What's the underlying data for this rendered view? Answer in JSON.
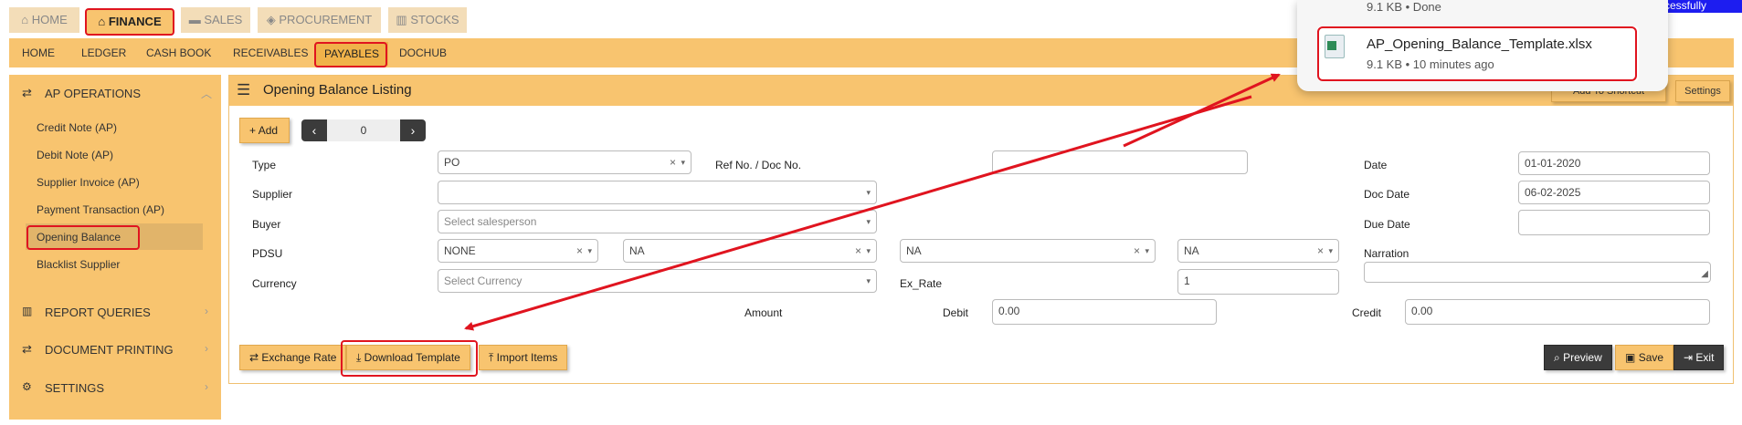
{
  "top_tabs": [
    "HOME",
    "FINANCE",
    "SALES",
    "PROCUREMENT",
    "STOCKS"
  ],
  "sub_nav": [
    "HOME",
    "LEDGER",
    "CASH BOOK",
    "RECEIVABLES",
    "PAYABLES",
    "DOCHUB"
  ],
  "sidebar": {
    "section": "AP OPERATIONS",
    "items": [
      "Credit Note (AP)",
      "Debit Note (AP)",
      "Supplier Invoice (AP)",
      "Payment Transaction (AP)",
      "Opening Balance",
      "Blacklist Supplier"
    ],
    "groups": [
      "REPORT QUERIES",
      "DOCUMENT PRINTING",
      "SETTINGS"
    ]
  },
  "panel": {
    "title": "Opening Balance Listing",
    "add_shortcut_label": "Add To Shortcut",
    "settings_label": "Settings",
    "add_label": "Add",
    "pager_value": "0"
  },
  "form": {
    "type_label": "Type",
    "type_value": "PO",
    "refno_label": "Ref No. / Doc No.",
    "refno_value": "",
    "date_label": "Date",
    "date_value": "01-01-2020",
    "supplier_label": "Supplier",
    "supplier_value": "",
    "docdate_label": "Doc Date",
    "docdate_value": "06-02-2025",
    "buyer_label": "Buyer",
    "buyer_placeholder": "Select salesperson",
    "duedate_label": "Due Date",
    "duedate_value": "",
    "pdsu_label": "PDSU",
    "pdsu_values": [
      "NONE",
      "NA",
      "NA",
      "NA"
    ],
    "narration_label": "Narration",
    "currency_label": "Currency",
    "currency_placeholder": "Select Currency",
    "exrate_label": "Ex_Rate",
    "exrate_value": "1",
    "amount_label": "Amount",
    "debit_label": "Debit",
    "debit_value": "0.00",
    "credit_label": "Credit",
    "credit_value": "0.00"
  },
  "actions": {
    "exchange_rate": "Exchange Rate",
    "download_template": "Download Template",
    "import_items": "Import Items",
    "preview": "Preview",
    "save": "Save",
    "exit": "Exit"
  },
  "download_popup": {
    "prev_status": "9.1 KB • Done",
    "filename": "AP_Opening_Balance_Template.xlsx",
    "status": "9.1 KB • 10 minutes ago"
  },
  "banner_text": "ccessfully",
  "colors": {
    "accent": "#f8c46f",
    "sidebar_bg": "#f8c46f",
    "highlight": "#e0141f",
    "banner": "#1d1df0"
  }
}
